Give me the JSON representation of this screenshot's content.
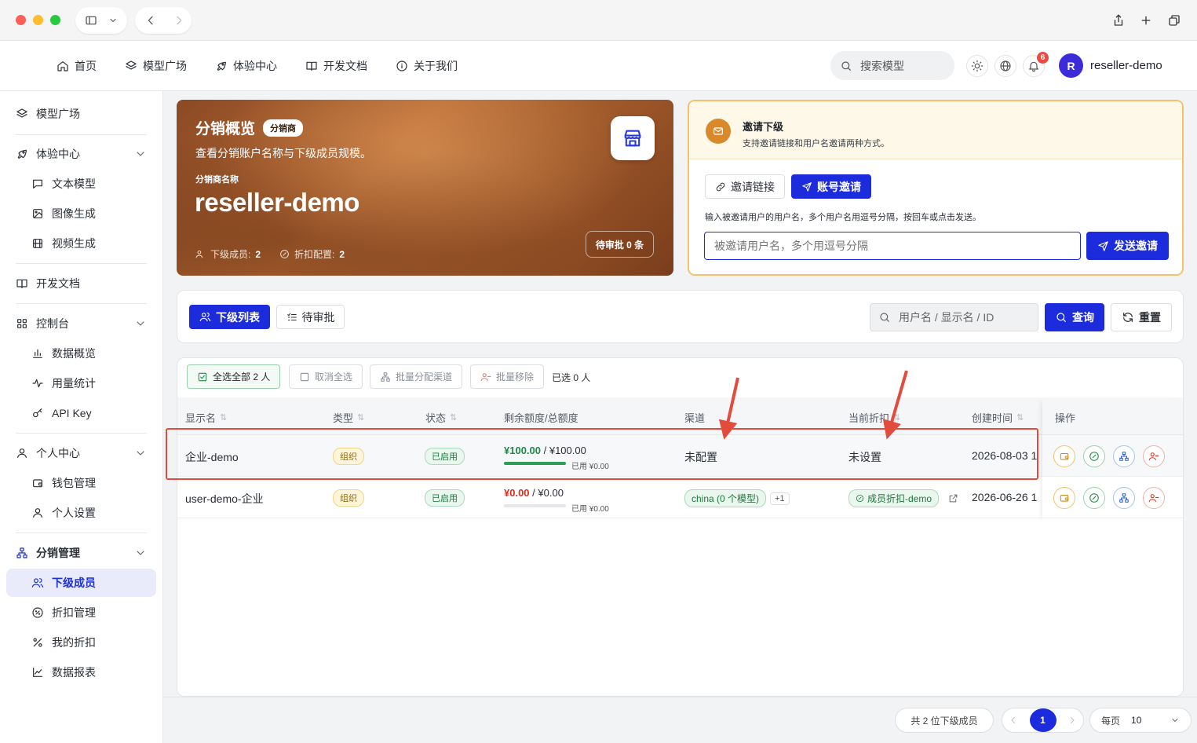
{
  "header": {
    "nav": [
      {
        "label": "首页",
        "icon": "home-icon"
      },
      {
        "label": "模型广场",
        "icon": "layers-icon"
      },
      {
        "label": "体验中心",
        "icon": "rocket-icon"
      },
      {
        "label": "开发文档",
        "icon": "book-icon"
      },
      {
        "label": "关于我们",
        "icon": "info-icon"
      }
    ],
    "search_label": "搜索模型",
    "notification_count": "6",
    "avatar_letter": "R",
    "username": "reseller-demo"
  },
  "sidebar": {
    "model_square": "模型广场",
    "experience": {
      "label": "体验中心",
      "items": [
        "文本模型",
        "图像生成",
        "视频生成"
      ]
    },
    "docs": "开发文档",
    "console": {
      "label": "控制台",
      "items": [
        "数据概览",
        "用量统计",
        "API Key"
      ]
    },
    "personal": {
      "label": "个人中心",
      "items": [
        "钱包管理",
        "个人设置"
      ]
    },
    "reseller": {
      "label": "分销管理",
      "items": [
        "下级成员",
        "折扣管理",
        "我的折扣",
        "数据报表"
      ]
    }
  },
  "hero": {
    "title": "分销概览",
    "badge": "分销商",
    "subtitle": "查看分销账户名称与下级成员规模。",
    "name_label": "分销商名称",
    "name": "reseller-demo",
    "members_label": "下级成员:",
    "members_value": "2",
    "discount_label": "折扣配置:",
    "discount_value": "2",
    "pending_button": "待审批 0 条"
  },
  "invite": {
    "title": "邀请下级",
    "desc": "支持邀请链接和用户名邀请两种方式。",
    "tab_link": "邀请链接",
    "tab_account": "账号邀请",
    "instruction": "输入被邀请用户的用户名，多个用户名用逗号分隔，按回车或点击发送。",
    "input_placeholder": "被邀请用户名，多个用逗号分隔",
    "send_button": "发送邀请"
  },
  "toolbar": {
    "tab_members": "下级列表",
    "tab_pending": "待审批",
    "search_placeholder": "用户名 / 显示名 / ID",
    "query_button": "查询",
    "reset_button": "重置"
  },
  "table": {
    "bulk": {
      "select_all": "全选全部 2 人",
      "deselect": "取消全选",
      "assign_channel": "批量分配渠道",
      "remove": "批量移除",
      "selected": "已选 0 人"
    },
    "columns": {
      "name": "显示名",
      "type": "类型",
      "status": "状态",
      "quota": "剩余额度/总额度",
      "channel": "渠道",
      "discount": "当前折扣",
      "created": "创建时间",
      "actions": "操作"
    },
    "rows": [
      {
        "name": "企业-demo",
        "type": "组织",
        "status": "已启用",
        "remaining": "¥100.00",
        "total": "/ ¥100.00",
        "used": "已用 ¥0.00",
        "quota_fraction": 1.0,
        "channel": "未配置",
        "discount": "未设置",
        "created": "2026-08-03 1"
      },
      {
        "name": "user-demo-企业",
        "type": "组织",
        "status": "已启用",
        "remaining": "¥0.00",
        "total": "/ ¥0.00",
        "used": "已用 ¥0.00",
        "quota_fraction": 0.0,
        "channel": "china (0 个模型)",
        "channel_extra": "+1",
        "discount": "成员折扣-demo",
        "created": "2026-06-26 1"
      }
    ]
  },
  "footer": {
    "total": "共 2 位下级成员",
    "page": "1",
    "per_page_label": "每页",
    "per_page_value": "10"
  },
  "colors": {
    "accent": "#1c2bdc",
    "success": "#1d7a3d",
    "danger": "#d9301f",
    "highlight": "#e24c3c"
  }
}
